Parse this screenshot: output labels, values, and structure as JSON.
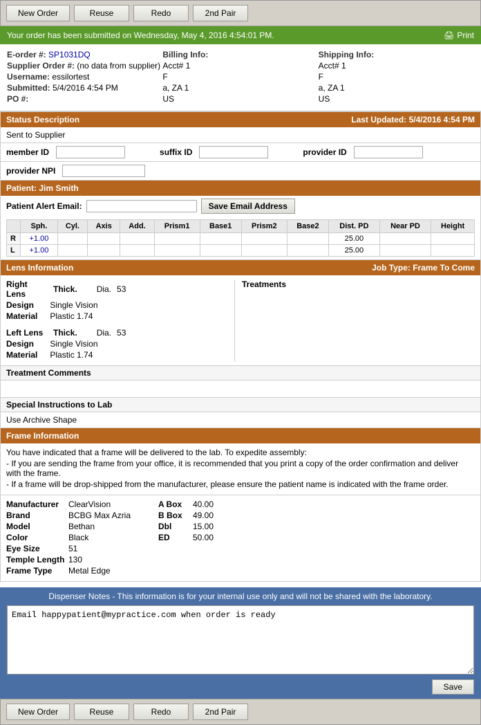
{
  "toolbar": {
    "buttons": [
      "New Order",
      "Reuse",
      "Redo",
      "2nd Pair"
    ]
  },
  "success_bar": {
    "message": "Your order has been submitted on Wednesday, May 4, 2016 4:54:01 PM.",
    "print_label": "Print"
  },
  "order_info": {
    "eorder_label": "E-order #:",
    "eorder_value": "SP1031DQ",
    "supplier_order_label": "Supplier Order #:",
    "supplier_order_value": "(no data from supplier)",
    "username_label": "Username:",
    "username_value": "essilortest",
    "submitted_label": "Submitted:",
    "submitted_value": "5/4/2016 4:54 PM",
    "po_label": "PO #:",
    "po_value": "",
    "billing_label": "Billing Info:",
    "billing_acct": "Acct# 1",
    "billing_f": "F",
    "billing_addr": "a, ZA 1",
    "billing_country": "US",
    "shipping_label": "Shipping Info:",
    "shipping_acct": "Acct# 1",
    "shipping_f": "F",
    "shipping_addr": "a, ZA 1",
    "shipping_country": "US"
  },
  "status": {
    "header": "Status Description",
    "last_updated_label": "Last Updated:",
    "last_updated_value": "5/4/2016 4:54 PM",
    "value": "Sent to Supplier"
  },
  "fields": {
    "member_id_label": "member ID",
    "suffix_id_label": "suffix ID",
    "provider_id_label": "provider ID",
    "provider_npi_label": "provider NPI"
  },
  "patient": {
    "header": "Patient: Jim Smith",
    "alert_email_label": "Patient Alert Email:",
    "save_email_btn": "Save Email Address"
  },
  "rx_table": {
    "headers": [
      "",
      "Sph.",
      "Cyl.",
      "Axis",
      "Add.",
      "Prism1",
      "Base1",
      "Prism2",
      "Base2",
      "Dist. PD",
      "Near PD",
      "Height"
    ],
    "rows": [
      {
        "label": "R",
        "sph": "+1.00",
        "cyl": "",
        "axis": "",
        "add": "",
        "prism1": "",
        "base1": "",
        "prism2": "",
        "base2": "",
        "dist_pd": "25.00",
        "near_pd": "",
        "height": ""
      },
      {
        "label": "L",
        "sph": "+1.00",
        "cyl": "",
        "axis": "",
        "add": "",
        "prism1": "",
        "base1": "",
        "prism2": "",
        "base2": "",
        "dist_pd": "25.00",
        "near_pd": "",
        "height": ""
      }
    ]
  },
  "lens": {
    "header": "Lens Information",
    "job_type_label": "Job Type:",
    "job_type_value": "Frame To Come",
    "right_lens_label": "Right Lens",
    "right_thick_label": "Thick.",
    "right_dia_label": "Dia.",
    "right_dia_value": "53",
    "right_design_label": "Design",
    "right_design_value": "Single Vision",
    "right_material_label": "Material",
    "right_material_value": "Plastic 1.74",
    "left_lens_label": "Left Lens",
    "left_thick_label": "Thick.",
    "left_dia_label": "Dia.",
    "left_dia_value": "53",
    "left_design_label": "Design",
    "left_design_value": "Single Vision",
    "left_material_label": "Material",
    "left_material_value": "Plastic 1.74",
    "treatments_label": "Treatments"
  },
  "treatment_comments": {
    "label": "Treatment Comments",
    "value": ""
  },
  "special_instructions": {
    "label": "Special Instructions to Lab",
    "value": "Use Archive Shape"
  },
  "frame": {
    "header": "Frame Information",
    "notice1": "You have indicated that a frame will be delivered to the lab. To expedite assembly:",
    "notice2": "- If you are sending the frame from your office, it is recommended that you print a copy of the order confirmation and deliver with the frame.",
    "notice3": "- If a frame will be drop-shipped from the manufacturer, please ensure the patient name is indicated with the frame order.",
    "manufacturer_label": "Manufacturer",
    "manufacturer_value": "ClearVision",
    "brand_label": "Brand",
    "brand_value": "BCBG Max Azria",
    "model_label": "Model",
    "model_value": "Bethan",
    "color_label": "Color",
    "color_value": "Black",
    "eye_size_label": "Eye Size",
    "eye_size_value": "51",
    "temple_length_label": "Temple Length",
    "temple_length_value": "130",
    "frame_type_label": "Frame Type",
    "frame_type_value": "Metal Edge",
    "a_box_label": "A Box",
    "a_box_value": "40.00",
    "b_box_label": "B Box",
    "b_box_value": "49.00",
    "dbl_label": "Dbl",
    "dbl_value": "15.00",
    "ed_label": "ED",
    "ed_value": "50.00"
  },
  "dispenser_notes": {
    "title": "Dispenser Notes - This information is for your internal use only and will not be shared with the laboratory.",
    "value": "Email happypatient@mypractice.com when order is ready",
    "save_label": "Save"
  }
}
